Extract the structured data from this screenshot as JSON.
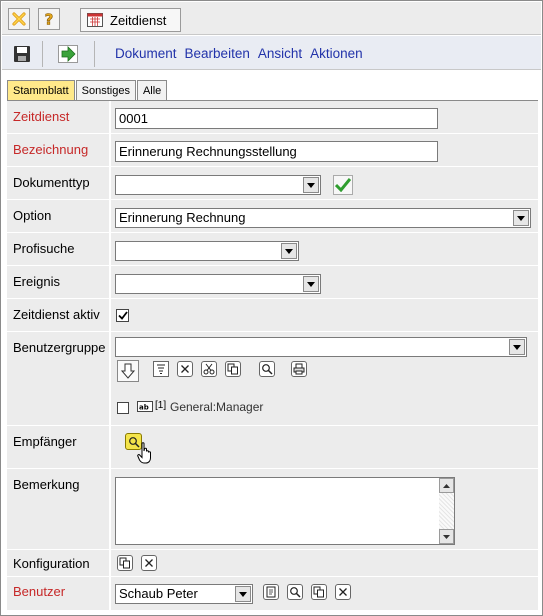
{
  "window": {
    "title_tab": "Zeitdienst"
  },
  "toolbar": {
    "menu": [
      "Dokument",
      "Bearbeiten",
      "Ansicht",
      "Aktionen"
    ]
  },
  "tabs": [
    {
      "label": "Stammblatt",
      "active": true
    },
    {
      "label": "Sonstiges",
      "active": false
    },
    {
      "label": "Alle",
      "active": false
    }
  ],
  "form": {
    "zeitdienst": {
      "label": "Zeitdienst",
      "value": "0001"
    },
    "bezeichnung": {
      "label": "Bezeichnung",
      "value": "Erinnerung Rechnungsstellung"
    },
    "dokumenttyp": {
      "label": "Dokumenttyp",
      "value": ""
    },
    "option": {
      "label": "Option",
      "value": "Erinnerung Rechnung"
    },
    "profisuche": {
      "label": "Profisuche",
      "value": ""
    },
    "ereignis": {
      "label": "Ereignis",
      "value": ""
    },
    "zeitdienst_aktiv": {
      "label": "Zeitdienst aktiv",
      "checked": true
    },
    "benutzergruppe": {
      "label": "Benutzergruppe",
      "value": "",
      "entry_tag": "[1]",
      "entry_label": "General:Manager"
    },
    "empfaenger": {
      "label": "Empfänger"
    },
    "bemerkung": {
      "label": "Bemerkung",
      "value": ""
    },
    "konfiguration": {
      "label": "Konfiguration"
    },
    "benutzer": {
      "label": "Benutzer",
      "value": "Schaub Peter"
    }
  },
  "colors": {
    "required_label": "#c62828",
    "active_tab": "#ffe98a",
    "menu_link": "#2233aa",
    "row_bg": "#ececec"
  }
}
